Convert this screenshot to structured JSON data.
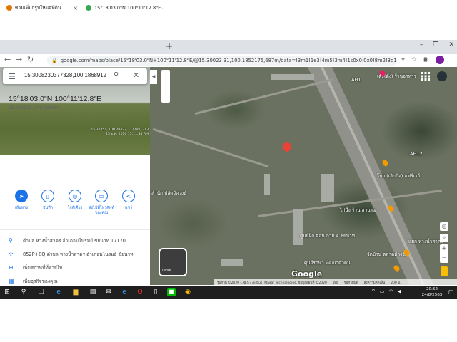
{
  "browser": {
    "tabs": [
      {
        "title": "ซ่อมเพิ่มกรูปโหนดที่ดิน",
        "active": false
      },
      {
        "title": "15°18'03.0\"N 100°11'12.8\"E - Goo",
        "active": true
      }
    ],
    "new_tab": "+",
    "url": "google.com/maps/place/15°18'03.0\"N+100°11'12.8\"E/@15.30023 31,100.1852175,687m/data=!3m1!1e3!4m5!3m4!1s0x0:0x0!8m2!3d15.3008231!4d100.1868912"
  },
  "search": {
    "value": "15.3008230377328,100.1868912",
    "icons": [
      "menu-icon",
      "search-icon",
      "close-icon"
    ]
  },
  "photo": {
    "caption_line1": "15.31451, 100.20427, -17 9m, 213",
    "caption_line2": "25 ต.ค. 2016 15:11:38 AM"
  },
  "place": {
    "title": "15°18'03.0\"N 100°11'12.8\"E",
    "subtitle": "15.300823, 100.186891"
  },
  "actions": [
    {
      "label": "เส้นทาง",
      "icon": "directions-icon"
    },
    {
      "label": "บันทึก",
      "icon": "bookmark-icon"
    },
    {
      "label": "ใกล้เคียง",
      "icon": "nearby-icon"
    },
    {
      "label": "ส่งไปที่โทรศัพท์ของคุณ",
      "icon": "send-to-phone-icon"
    },
    {
      "label": "แชร์",
      "icon": "share-icon"
    }
  ],
  "info_rows": [
    {
      "icon": "location-pin-icon",
      "text": "ตำบล หางน้ำสาคร อำเภอมโนรมย์ ชัยนาท 17170"
    },
    {
      "icon": "plus-code-icon",
      "text": "852P+8Q ตำบล หางน้ำสาคร อำเภอมโนรมย์ ชัยนาท"
    },
    {
      "icon": "add-place-icon",
      "text": "เพิ่มสถานที่ที่หายไป"
    },
    {
      "icon": "add-business-icon",
      "text": "เพิ่มธุรกิจของคุณ"
    }
  ],
  "map": {
    "labels": [
      {
        "text": "AH1"
      },
      {
        "text": "AH12"
      },
      {
        "text": "เต๊ะ(ตั้ง) ร้านอาหาร"
      },
      {
        "text": "โกย (เลิกกิจ) แฟร์เวย์"
      },
      {
        "text": "ไก่นึ่ง ร้าน สวนพอ"
      },
      {
        "text": "สำนัก ปลัดวัดวงษ์"
      },
      {
        "text": "ศูนย์ฝึก ตอน กาย 4 ชัยนาท"
      },
      {
        "text": "วัดบ้าน ตลาดต่างวัย"
      },
      {
        "text": "แยก หางน้ำสาคร"
      },
      {
        "text": "ศูนย์รักษา พัฒนาตัวตน"
      }
    ],
    "layers_label": "แผนที่",
    "google": "Google",
    "attribution": [
      "รูปภาพ ©2020 CNES / Airbus, Maxar Technologies, ข้อมูลแผนที่ ©2020",
      "ไทย",
      "ข้อกำหนด",
      "ส่งความคิดเห็น",
      "200 ม."
    ]
  },
  "taskbar": {
    "time": "20:52",
    "date": "24/8/2563"
  },
  "colors": {
    "accent": "#1a73e8",
    "pin": "#ea4335",
    "poi": "#f29900"
  }
}
